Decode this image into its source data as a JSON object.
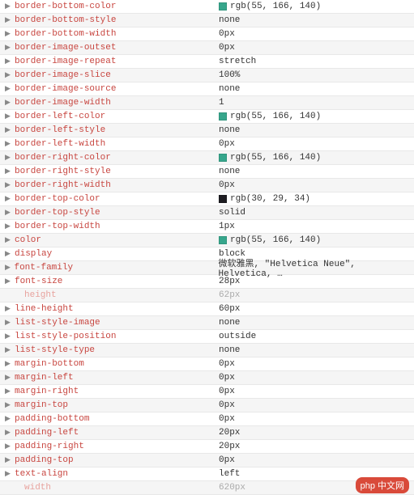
{
  "rows": [
    {
      "name": "border-bottom-color",
      "value": "rgb(55, 166, 140)",
      "swatch": "#37a68c",
      "arrow": true
    },
    {
      "name": "border-bottom-style",
      "value": "none",
      "arrow": true
    },
    {
      "name": "border-bottom-width",
      "value": "0px",
      "arrow": true
    },
    {
      "name": "border-image-outset",
      "value": "0px",
      "arrow": true
    },
    {
      "name": "border-image-repeat",
      "value": "stretch",
      "arrow": true
    },
    {
      "name": "border-image-slice",
      "value": "100%",
      "arrow": true
    },
    {
      "name": "border-image-source",
      "value": "none",
      "arrow": true
    },
    {
      "name": "border-image-width",
      "value": "1",
      "arrow": true
    },
    {
      "name": "border-left-color",
      "value": "rgb(55, 166, 140)",
      "swatch": "#37a68c",
      "arrow": true
    },
    {
      "name": "border-left-style",
      "value": "none",
      "arrow": true
    },
    {
      "name": "border-left-width",
      "value": "0px",
      "arrow": true
    },
    {
      "name": "border-right-color",
      "value": "rgb(55, 166, 140)",
      "swatch": "#37a68c",
      "arrow": true
    },
    {
      "name": "border-right-style",
      "value": "none",
      "arrow": true
    },
    {
      "name": "border-right-width",
      "value": "0px",
      "arrow": true
    },
    {
      "name": "border-top-color",
      "value": "rgb(30, 29, 34)",
      "swatch": "#1e1d22",
      "arrow": true
    },
    {
      "name": "border-top-style",
      "value": "solid",
      "arrow": true
    },
    {
      "name": "border-top-width",
      "value": "1px",
      "arrow": true
    },
    {
      "name": "color",
      "value": "rgb(55, 166, 140)",
      "swatch": "#37a68c",
      "arrow": true
    },
    {
      "name": "display",
      "value": "block",
      "arrow": true
    },
    {
      "name": "font-family",
      "value": "微软雅黑, \"Helvetica Neue\", Helvetica, …",
      "arrow": true
    },
    {
      "name": "font-size",
      "value": "28px",
      "arrow": true
    },
    {
      "name": "height",
      "value": "62px",
      "dim": true
    },
    {
      "name": "line-height",
      "value": "60px",
      "arrow": true
    },
    {
      "name": "list-style-image",
      "value": "none",
      "arrow": true
    },
    {
      "name": "list-style-position",
      "value": "outside",
      "arrow": true
    },
    {
      "name": "list-style-type",
      "value": "none",
      "arrow": true
    },
    {
      "name": "margin-bottom",
      "value": "0px",
      "arrow": true
    },
    {
      "name": "margin-left",
      "value": "0px",
      "arrow": true
    },
    {
      "name": "margin-right",
      "value": "0px",
      "arrow": true
    },
    {
      "name": "margin-top",
      "value": "0px",
      "arrow": true
    },
    {
      "name": "padding-bottom",
      "value": "0px",
      "arrow": true
    },
    {
      "name": "padding-left",
      "value": "20px",
      "arrow": true
    },
    {
      "name": "padding-right",
      "value": "20px",
      "arrow": true
    },
    {
      "name": "padding-top",
      "value": "0px",
      "arrow": true
    },
    {
      "name": "text-align",
      "value": "left",
      "arrow": true
    },
    {
      "name": "width",
      "value": "620px",
      "dim": true
    }
  ],
  "watermark": "php 中文网"
}
